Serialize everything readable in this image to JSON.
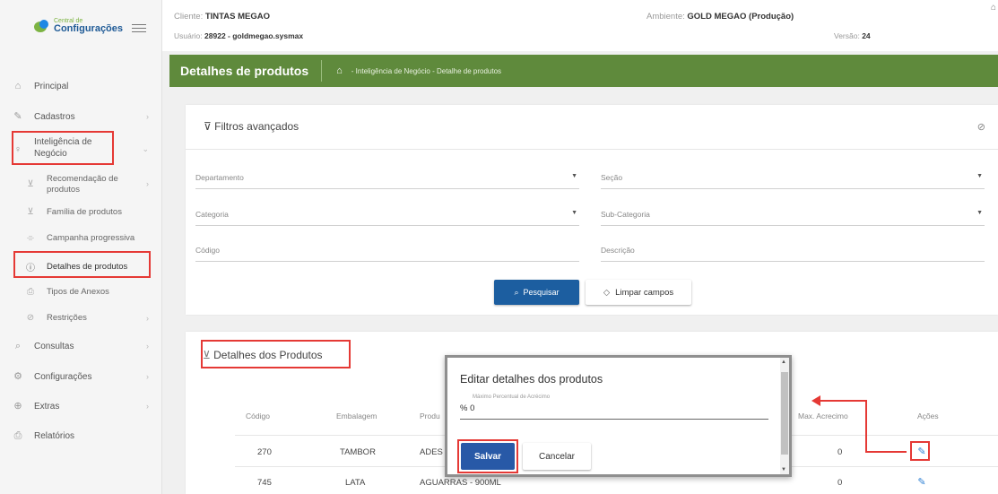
{
  "header": {
    "cliente_label": "Cliente:",
    "cliente_value": "TINTAS MEGAO",
    "usuario_label": "Usuário:",
    "usuario_value": "28922 - goldmegao.sysmax",
    "ambiente_label": "Ambiente:",
    "ambiente_value": "GOLD MEGAO (Produção)",
    "versao_label": "Versão:",
    "versao_value": "24"
  },
  "logo": {
    "small": "Central de",
    "big": "Configurações"
  },
  "sidebar": {
    "items": [
      {
        "label": "Principal",
        "icon": "home-icon"
      },
      {
        "label": "Cadastros",
        "icon": "edit-icon"
      },
      {
        "label": "Inteligência de\nNegócio",
        "icon": "lightbulb-icon"
      },
      {
        "label": "Consultas",
        "icon": "search-icon"
      },
      {
        "label": "Configurações",
        "icon": "gear-icon"
      },
      {
        "label": "Extras",
        "icon": "plus-circle-icon"
      },
      {
        "label": "Relatórios",
        "icon": "printer-icon"
      }
    ],
    "subitems": [
      {
        "label": "Recomendação de produtos",
        "icon": "basket-icon"
      },
      {
        "label": "Família de produtos",
        "icon": "basket-icon"
      },
      {
        "label": "Campanha progressiva",
        "icon": "chart-icon"
      },
      {
        "label": "Detalhes de produtos",
        "icon": "info-icon"
      },
      {
        "label": "Tipos de Anexos",
        "icon": "paperclip-icon"
      },
      {
        "label": "Restrições",
        "icon": "block-icon"
      }
    ]
  },
  "titlebar": {
    "title": "Detalhes de produtos",
    "breadcrumb": "- Inteligência de Negócio - Detalhe de produtos"
  },
  "filters": {
    "title": "Filtros avançados",
    "departamento": "Departamento",
    "secao": "Seção",
    "categoria": "Categoria",
    "subcategoria": "Sub-Categoria",
    "codigo": "Código",
    "descricao": "Descrição",
    "search_label": "Pesquisar",
    "clear_label": "Limpar campos"
  },
  "details": {
    "title": "Detalhes dos Produtos",
    "columns": [
      "Código",
      "Embalagem",
      "Produ",
      "Max. Acrecimo",
      "Ações"
    ],
    "rows": [
      {
        "codigo": "270",
        "embalagem": "TAMBOR",
        "produto": "ADES",
        "max": "0"
      },
      {
        "codigo": "745",
        "embalagem": "LATA",
        "produto": "AGUARRAS - 900ML",
        "max": "0"
      }
    ]
  },
  "modal": {
    "title": "Editar detalhes dos produtos",
    "field_label": "Máximo Percentual de Acrécimo",
    "field_value": "% 0",
    "save_label": "Salvar",
    "cancel_label": "Cancelar"
  },
  "colors": {
    "accent_green": "#5f8a3c",
    "primary_blue": "#1c5ea0",
    "annotation_red": "#e53935"
  }
}
